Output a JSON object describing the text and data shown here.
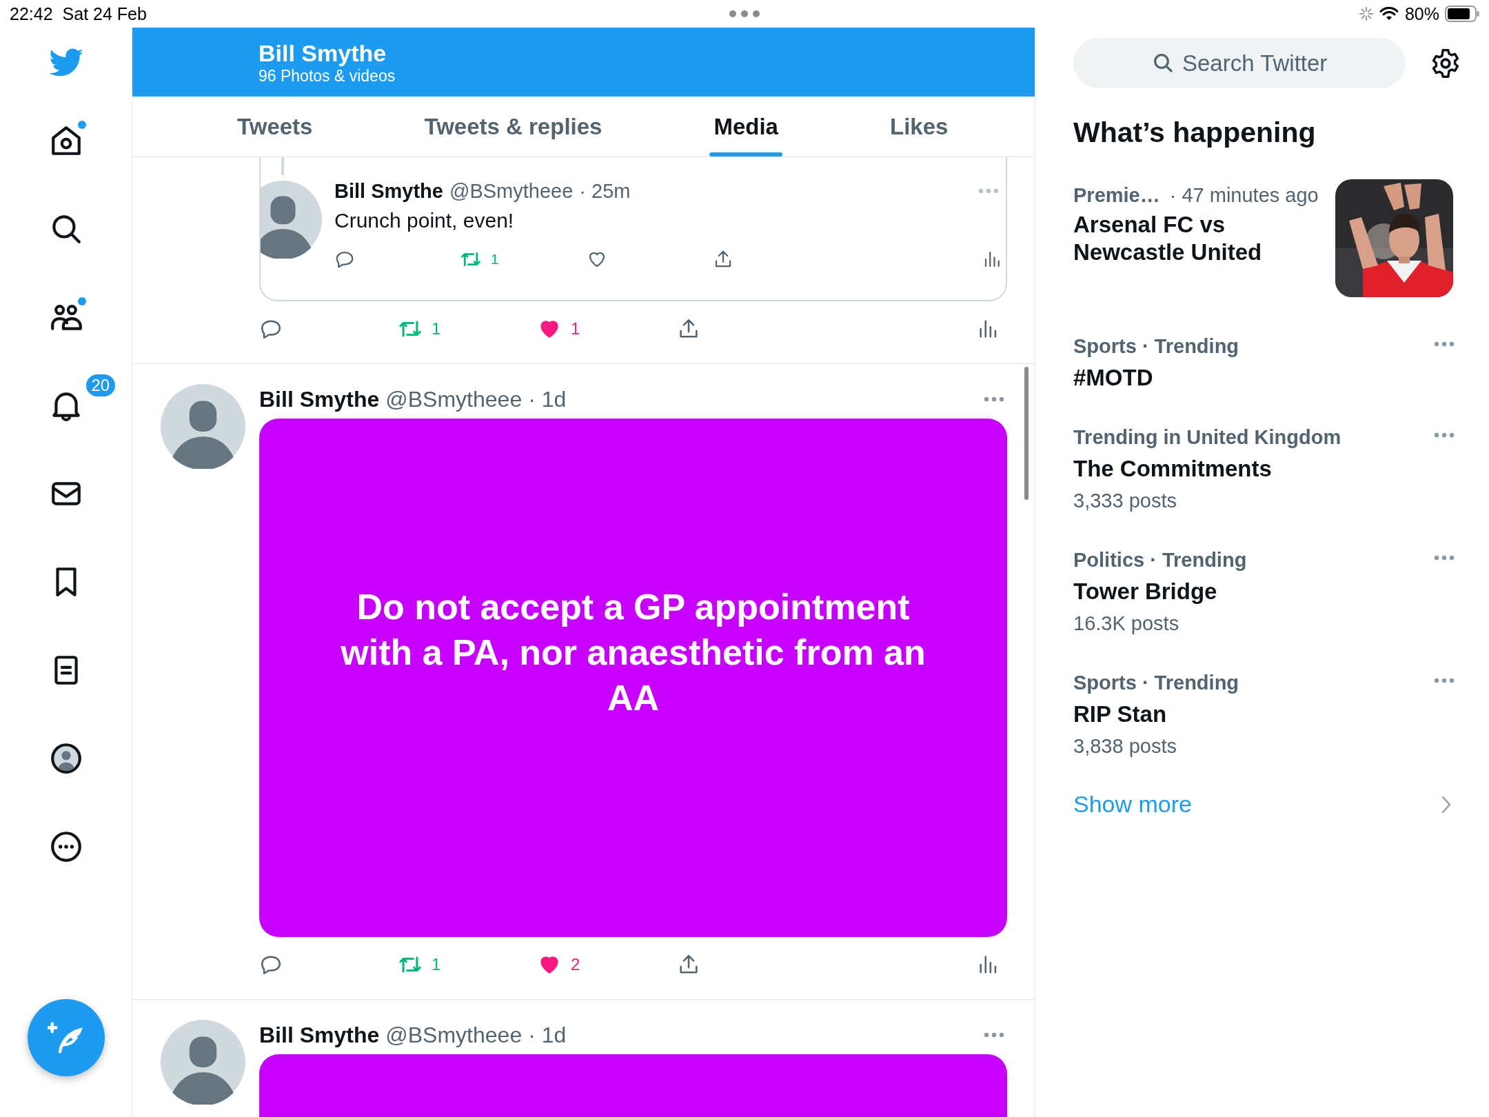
{
  "status_bar": {
    "time": "22:42",
    "date": "Sat 24 Feb",
    "battery": "80%"
  },
  "nav": {
    "items": [
      {
        "kind": "logo"
      },
      {
        "kind": "home",
        "dot": true
      },
      {
        "kind": "search",
        "dot": false
      },
      {
        "kind": "communities",
        "dot": true
      },
      {
        "kind": "notifications",
        "dot": false,
        "badge": "20"
      },
      {
        "kind": "messages",
        "dot": false
      },
      {
        "kind": "bookmarks",
        "dot": false
      },
      {
        "kind": "lists",
        "dot": false
      },
      {
        "kind": "profile",
        "dot": false
      },
      {
        "kind": "more",
        "dot": false
      }
    ]
  },
  "header": {
    "name": "Bill Smythe",
    "subtitle": "96 Photos & videos"
  },
  "tabs": [
    {
      "label": "Tweets",
      "selected": false
    },
    {
      "label": "Tweets & replies",
      "selected": false
    },
    {
      "label": "Media",
      "selected": true
    },
    {
      "label": "Likes",
      "selected": false
    }
  ],
  "tweets": [
    {
      "kind": "quote_tail",
      "quote": {
        "name": "Bill Smythe",
        "handle": "@BSmytheee",
        "time": "· 25m",
        "text": "Crunch point, even!",
        "actions": [
          {
            "kind": "reply"
          },
          {
            "kind": "retweet",
            "count": "1",
            "active": true
          },
          {
            "kind": "like",
            "active": false
          },
          {
            "kind": "share"
          },
          {
            "kind": "views"
          }
        ]
      },
      "actions": [
        {
          "kind": "reply"
        },
        {
          "kind": "retweet",
          "count": "1",
          "active": true
        },
        {
          "kind": "like",
          "count": "1",
          "active": true
        },
        {
          "kind": "share"
        },
        {
          "kind": "views"
        }
      ]
    },
    {
      "kind": "media",
      "name": "Bill Smythe",
      "handle": "@BSmytheee",
      "time": "· 1d",
      "media_text": "Do not accept a GP appointment with a PA, nor anaesthetic from an AA",
      "actions": [
        {
          "kind": "reply"
        },
        {
          "kind": "retweet",
          "count": "1",
          "active": true
        },
        {
          "kind": "like",
          "count": "2",
          "active": true
        },
        {
          "kind": "share"
        },
        {
          "kind": "views"
        }
      ]
    },
    {
      "kind": "media",
      "name": "Bill Smythe",
      "handle": "@BSmytheee",
      "time": "· 1d"
    }
  ],
  "sidebar": {
    "search": {
      "placeholder": "Search Twitter"
    },
    "title": "What’s happening",
    "trends": [
      {
        "kind": "event",
        "category": "Premie…",
        "time": "· 47 minutes ago",
        "title": "Arsenal FC vs Newcastle United"
      },
      {
        "kind": "trend",
        "category": "Sports · Trending",
        "title": "#MOTD"
      },
      {
        "kind": "trend",
        "category": "Trending in United Kingdom",
        "title": "The Commitments",
        "posts": "3,333 posts"
      },
      {
        "kind": "trend",
        "category": "Politics · Trending",
        "title": "Tower Bridge",
        "posts": "16.3K posts"
      },
      {
        "kind": "trend",
        "category": "Sports · Trending",
        "title": "RIP Stan",
        "posts": "3,838 posts"
      }
    ],
    "show_more": "Show more"
  }
}
